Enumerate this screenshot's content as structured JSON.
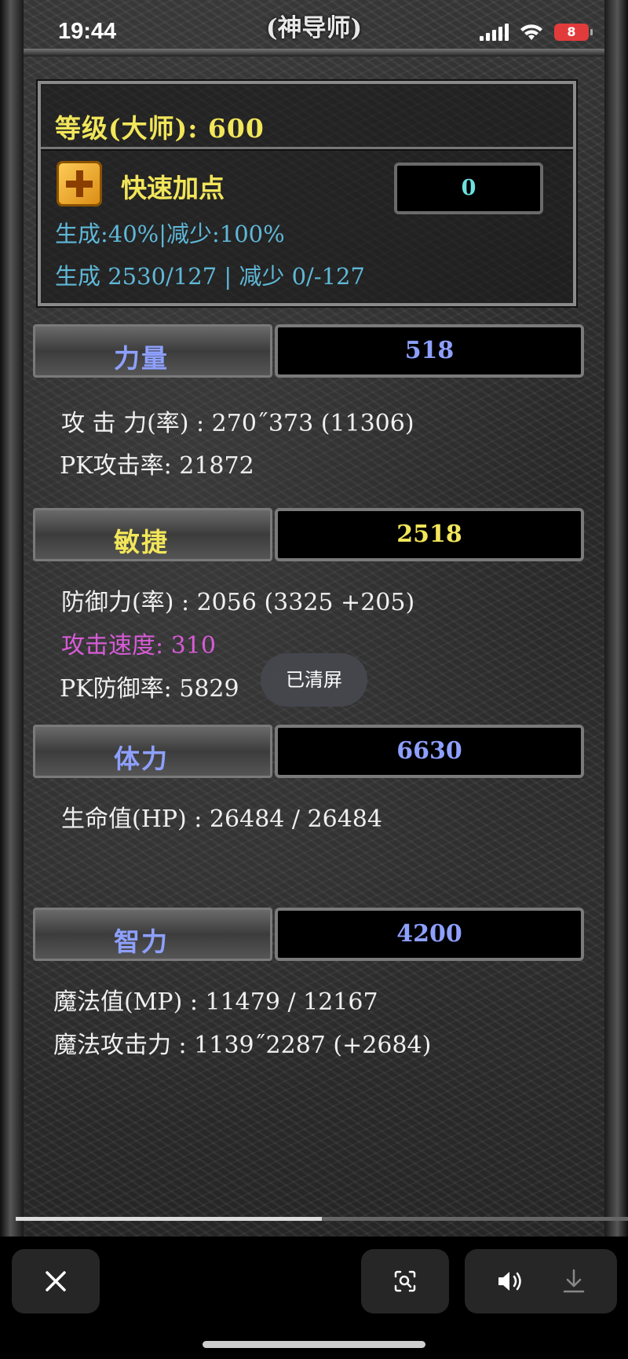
{
  "status_bar": {
    "time": "19:44",
    "battery": "8",
    "title": "(神导师)"
  },
  "top_panel": {
    "level_label": "等级(大师): 600",
    "quick_label": "快速加点",
    "points": "0",
    "gen_rate": "生成:40%|减少:100%",
    "gen_amount": "生成 2530/127 | 减少 0/-127"
  },
  "stats": [
    {
      "name": "力量",
      "value": "518",
      "lines": [
        "攻 击 力(率) : 270˝373 (11306)",
        "PK攻击率: 21872"
      ]
    },
    {
      "name": "敏捷",
      "value": "2518",
      "lines": [
        "防御力(率) : 2056 (3325 +205)",
        "攻击速度: 310",
        "PK防御率: 5829"
      ]
    },
    {
      "name": "体力",
      "value": "6630",
      "lines": [
        "生命值(HP) : 26484 / 26484"
      ]
    },
    {
      "name": "智力",
      "value": "4200",
      "lines": [
        "魔法值(MP) : 11479 / 12167",
        "魔法攻击力 : 1139˝2287 (+2684)"
      ]
    }
  ],
  "toast": "已清屏",
  "video_progress": 0.5,
  "bottom_bar": {
    "icons": [
      "close-icon",
      "screenshot-scan-icon",
      "volume-icon",
      "download-icon"
    ]
  },
  "colors": {
    "yellow": "#f2e65a",
    "blue": "#8ea0ff",
    "cyan": "#6fe0e0",
    "magenta": "#d85bd8",
    "info": "#5fb8d8"
  }
}
